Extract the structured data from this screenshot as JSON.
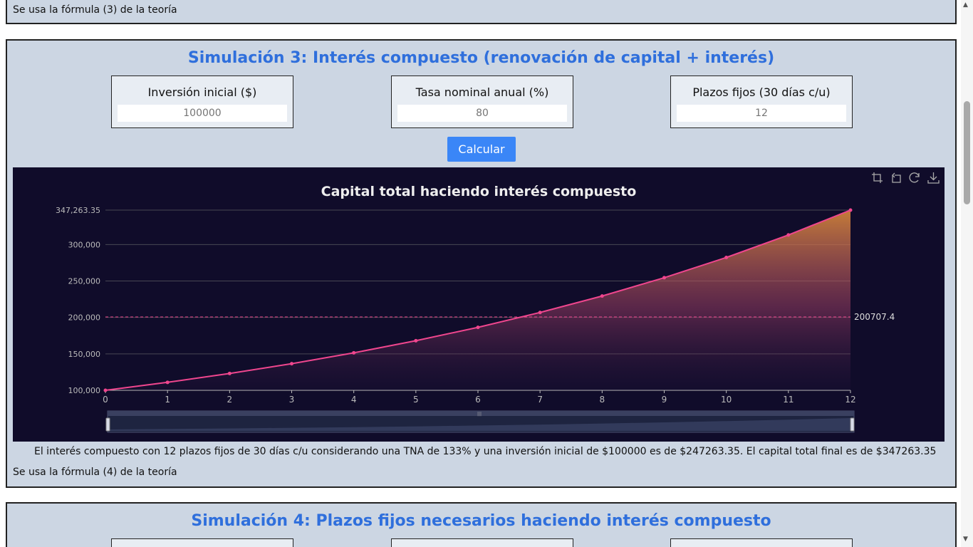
{
  "top_card": {
    "note": "Se usa la fórmula (3) de la teoría"
  },
  "sim3": {
    "title": "Simulación 3: Interés compuesto (renovación de capital + interés)",
    "inputs": [
      {
        "label": "Inversión inicial ($)",
        "placeholder": "100000"
      },
      {
        "label": "Tasa nominal anual (%)",
        "placeholder": "80"
      },
      {
        "label": "Plazos fijos (30 días c/u)",
        "placeholder": "12"
      }
    ],
    "button": "Calcular",
    "result": "El interés compuesto con 12 plazos fijos de 30 días c/u considerando una TNA de 133% y una inversión inicial de $100000 es de $247263.35. El capital total final es de $347263.35",
    "note": "Se usa la fórmula (4) de la teoría"
  },
  "sim4": {
    "title": "Simulación 4: Plazos fijos necesarios haciendo interés compuesto"
  },
  "toolbox": [
    "zoom-icon",
    "zoom-reset-icon",
    "restore-icon",
    "download-icon"
  ],
  "chart_data": {
    "type": "area",
    "title": "Capital total haciendo interés compuesto",
    "x": [
      0,
      1,
      2,
      3,
      4,
      5,
      6,
      7,
      8,
      9,
      10,
      11,
      12
    ],
    "series": [
      {
        "values": [
          100000,
          110930,
          123065,
          136522,
          151450,
          168016,
          186389,
          206776,
          229390,
          254480,
          282310,
          313170,
          347263.35
        ]
      }
    ],
    "ylim": [
      100000,
      347263.35
    ],
    "yticks": [
      "100,000",
      "150,000",
      "200,000",
      "250,000",
      "300,000",
      "347,263.35"
    ],
    "mark_line": {
      "value": 200707.4,
      "label": "200707.4"
    },
    "grid": true,
    "colors": {
      "line": "#f0468e",
      "area_top": "#d9883a",
      "background": "#100c2a"
    }
  }
}
